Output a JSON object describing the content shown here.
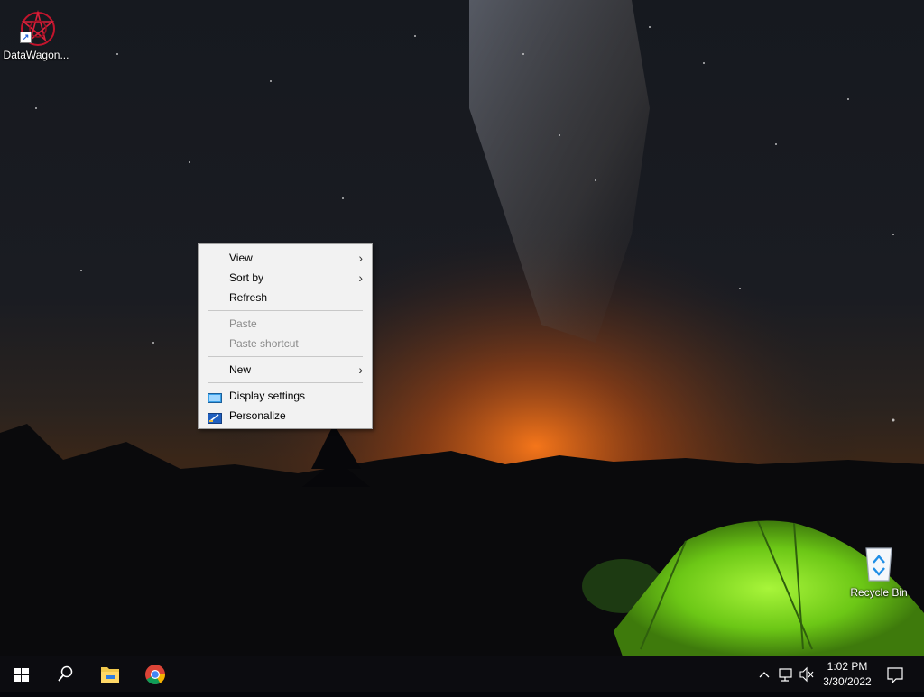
{
  "desktop": {
    "icons": [
      {
        "name": "DataWagon...",
        "icon": "datawagon-app-icon"
      },
      {
        "name": "Recycle Bin",
        "icon": "recycle-bin-icon"
      }
    ]
  },
  "context_menu": {
    "items": [
      {
        "label": "View",
        "submenu": true,
        "enabled": true
      },
      {
        "label": "Sort by",
        "submenu": true,
        "enabled": true
      },
      {
        "label": "Refresh",
        "enabled": true
      },
      {
        "label": "Paste",
        "enabled": false
      },
      {
        "label": "Paste shortcut",
        "enabled": false
      },
      {
        "label": "New",
        "submenu": true,
        "enabled": true
      },
      {
        "label": "Display settings",
        "icon": "display-settings-icon",
        "enabled": true
      },
      {
        "label": "Personalize",
        "icon": "personalize-icon",
        "enabled": true
      }
    ]
  },
  "taskbar": {
    "pinned": [
      {
        "name": "Start",
        "icon": "windows-logo-icon"
      },
      {
        "name": "Search",
        "icon": "search-icon"
      },
      {
        "name": "File Explorer",
        "icon": "folder-icon"
      },
      {
        "name": "Google Chrome",
        "icon": "chrome-icon"
      }
    ],
    "tray": {
      "chevron": "^",
      "time": "1:02 PM",
      "date": "3/30/2022"
    }
  },
  "colors": {
    "menu_bg": "#f2f2f2",
    "menu_disabled": "#8b8b8b",
    "taskbar_bg": "#0c0c10",
    "tent_green": "#7ddc1f",
    "horizon_glow": "#e0661a"
  }
}
